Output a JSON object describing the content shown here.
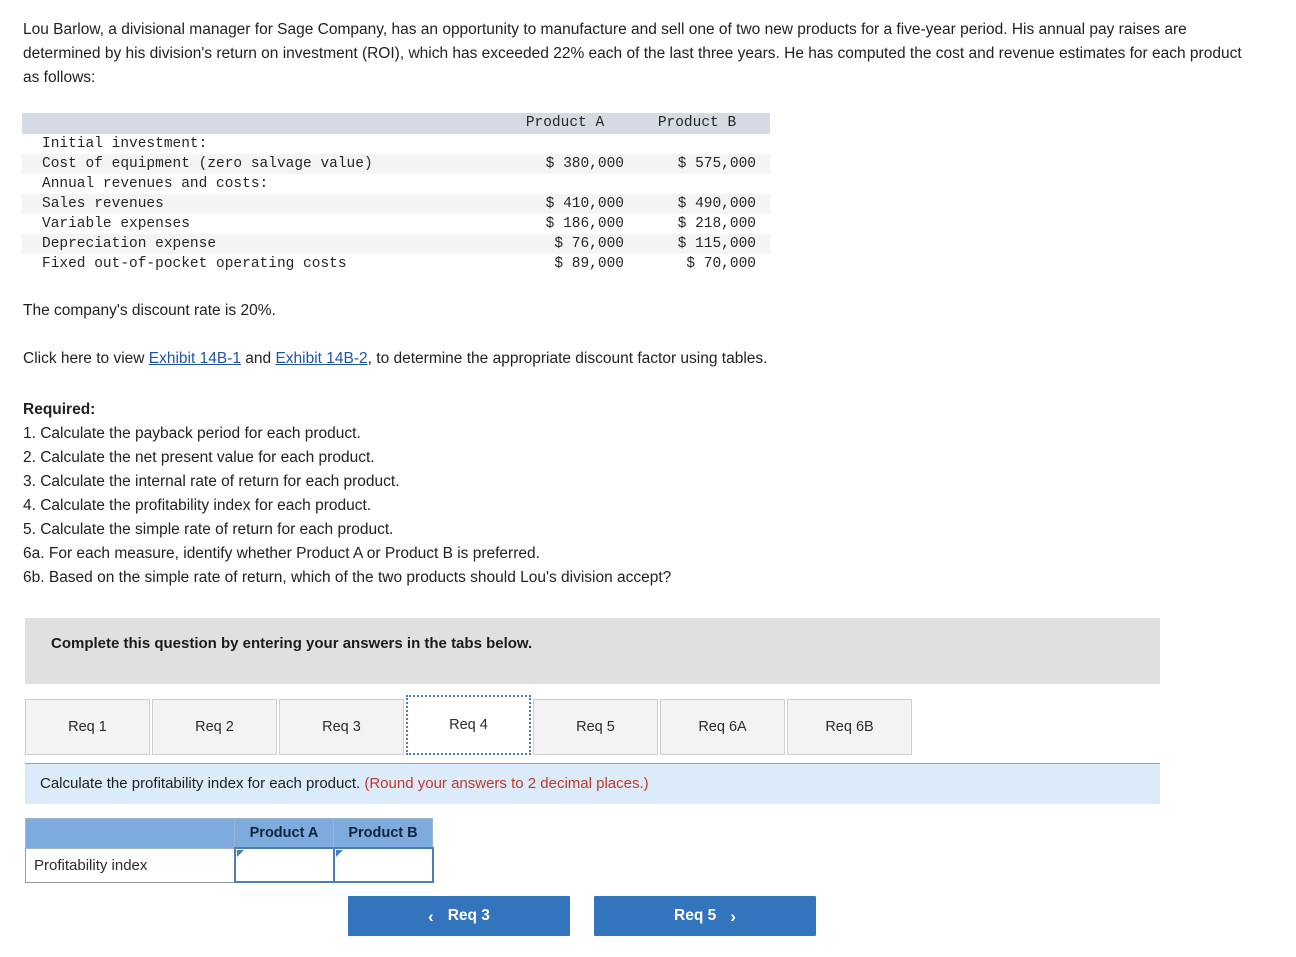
{
  "intro": {
    "paragraph": "Lou Barlow, a divisional manager for Sage Company, has an opportunity to manufacture and sell one of two new products for a five-year period. His annual pay raises are determined by his division's return on investment (ROI), which has exceeded 22% each of the last three years. He has computed the cost and revenue estimates for each product as follows:"
  },
  "data_table": {
    "col_headers": [
      "",
      "Product A",
      "Product B"
    ],
    "rows": [
      {
        "label": "Initial investment:",
        "a": "",
        "b": "",
        "shaded": false
      },
      {
        "label": "Cost of equipment (zero salvage value)",
        "a": "$ 380,000",
        "b": "$ 575,000",
        "shaded": true
      },
      {
        "label": "Annual revenues and costs:",
        "a": "",
        "b": "",
        "shaded": false
      },
      {
        "label": "Sales revenues",
        "a": "$ 410,000",
        "b": "$ 490,000",
        "shaded": true
      },
      {
        "label": "Variable expenses",
        "a": "$ 186,000",
        "b": "$ 218,000",
        "shaded": false
      },
      {
        "label": "Depreciation expense",
        "a": "$ 76,000",
        "b": "$ 115,000",
        "shaded": true
      },
      {
        "label": "Fixed out-of-pocket operating costs",
        "a": "$ 89,000",
        "b": "$ 70,000",
        "shaded": false
      }
    ]
  },
  "discount": {
    "rate_line": "The company's discount rate is 20%.",
    "exhibit_prefix": "Click here to view ",
    "exhibit_1": "Exhibit 14B-1",
    "exhibit_middle": " and ",
    "exhibit_2": "Exhibit 14B-2",
    "exhibit_suffix": ", to determine the appropriate discount factor using tables."
  },
  "required": {
    "title": "Required:",
    "items": [
      "1. Calculate the payback period for each product.",
      "2. Calculate the net present value for each product.",
      "3. Calculate the internal rate of return for each product.",
      "4. Calculate the profitability index for each product.",
      "5. Calculate the simple rate of return for each product.",
      "6a. For each measure, identify whether Product A or Product B is preferred.",
      "6b. Based on the simple rate of return, which of the two products should Lou's division accept?"
    ]
  },
  "banner": {
    "text": "Complete this question by entering your answers in the tabs below."
  },
  "tabs": {
    "items": [
      {
        "label": "Req 1",
        "active": false
      },
      {
        "label": "Req 2",
        "active": false
      },
      {
        "label": "Req 3",
        "active": false
      },
      {
        "label": "Req 4",
        "active": true
      },
      {
        "label": "Req 5",
        "active": false
      },
      {
        "label": "Req 6A",
        "active": false
      },
      {
        "label": "Req 6B",
        "active": false
      }
    ]
  },
  "instruction": {
    "main": "Calculate the profitability index for each product. ",
    "note": "(Round your answers to 2 decimal places.)"
  },
  "answer_table": {
    "corner": "",
    "col_a": "Product A",
    "col_b": "Product B",
    "row_label": "Profitability index",
    "value_a": "",
    "value_b": ""
  },
  "nav": {
    "prev_label": "Req 3",
    "next_label": "Req 5",
    "prev_chevron": "‹",
    "next_chevron": "›"
  },
  "colors": {
    "button_blue": "#3275bc",
    "header_blue": "#7dabdd",
    "instruction_blue": "#dbebf9",
    "banner_gray": "#e0e0e0",
    "table_header_gray": "#d6dae3",
    "link_blue": "#2155a8",
    "note_red": "#c0392b"
  }
}
